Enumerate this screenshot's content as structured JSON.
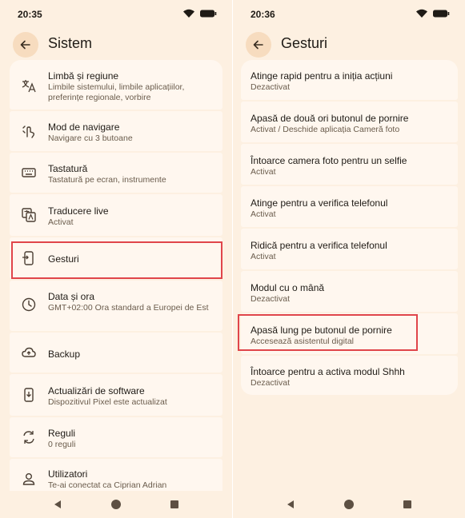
{
  "left": {
    "time": "20:35",
    "title": "Sistem",
    "items": [
      {
        "title": "Limbă și regiune",
        "subtitle": "Limbile sistemului, limbile aplicațiilor, preferințe regionale, vorbire",
        "icon": "translate-icon"
      },
      {
        "title": "Mod de navigare",
        "subtitle": "Navigare cu 3 butoane",
        "icon": "gesture-hand-icon"
      },
      {
        "title": "Tastatură",
        "subtitle": "Tastatură pe ecran, instrumente",
        "icon": "keyboard-icon"
      },
      {
        "title": "Traducere live",
        "subtitle": "Activat",
        "icon": "live-translate-icon"
      },
      {
        "title": "Gesturi",
        "subtitle": "",
        "icon": "phone-gesture-icon"
      },
      {
        "title": "Data și ora",
        "subtitle": "GMT+02:00 Ora standard a Europei de Est",
        "icon": "clock-icon"
      },
      {
        "title": "Backup",
        "subtitle": "",
        "icon": "cloud-upload-icon"
      },
      {
        "title": "Actualizări de software",
        "subtitle": "Dispozitivul Pixel este actualizat",
        "icon": "system-update-icon"
      },
      {
        "title": "Reguli",
        "subtitle": "0 reguli",
        "icon": "rules-icon"
      },
      {
        "title": "Utilizatori",
        "subtitle": "Te-ai conectat ca Ciprian Adrian",
        "icon": "person-icon"
      }
    ]
  },
  "right": {
    "time": "20:36",
    "title": "Gesturi",
    "items": [
      {
        "title": "Atinge rapid pentru a iniția acțiuni",
        "subtitle": "Dezactivat"
      },
      {
        "title": "Apasă de două ori butonul de pornire",
        "subtitle": "Activat / Deschide aplicația Cameră foto"
      },
      {
        "title": "Întoarce camera foto pentru un selfie",
        "subtitle": "Activat"
      },
      {
        "title": "Atinge pentru a verifica telefonul",
        "subtitle": "Activat"
      },
      {
        "title": "Ridică pentru a verifica telefonul",
        "subtitle": "Activat"
      },
      {
        "title": "Modul cu o mână",
        "subtitle": "Dezactivat"
      },
      {
        "title": "Apasă lung pe butonul de pornire",
        "subtitle": "Accesează asistentul digital"
      },
      {
        "title": "Întoarce pentru a activa modul Shhh",
        "subtitle": "Dezactivat"
      }
    ]
  },
  "colors": {
    "background": "#fdf0e1",
    "card": "#fff7ef",
    "accent": "#f7dcbf",
    "highlight": "#e0454a"
  }
}
